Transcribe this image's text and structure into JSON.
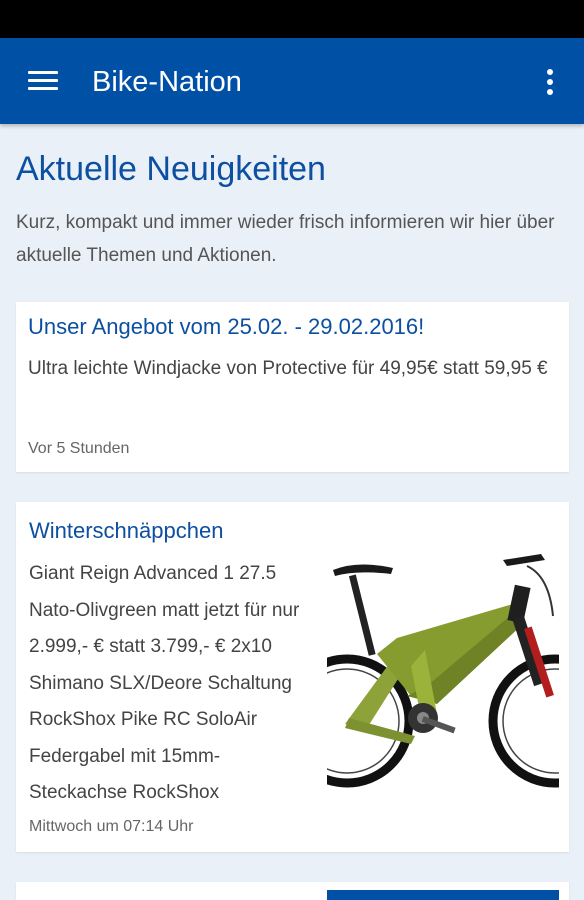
{
  "app": {
    "title": "Bike-Nation"
  },
  "header": {
    "menu_icon": "hamburger-menu-icon",
    "overflow_icon": "more-vertical-icon",
    "bar_color": "#0050a6"
  },
  "page": {
    "heading": "Aktuelle Neuigkeiten",
    "intro": "Kurz, kompakt und immer wieder frisch informieren wir hier über aktuelle Themen und Aktionen."
  },
  "news": [
    {
      "title": "Unser Angebot vom 25.02. - 29.02.2016!",
      "text": "Ultra leichte Windjacke von Protective für 49,95€ statt 59,95 €",
      "time": "Vor 5 Stunden"
    },
    {
      "title": "Winterschnäppchen",
      "text": "Giant Reign Advanced 1 27.5 Nato-Olivgreen matt jetzt für nur 2.999,- € statt 3.799,- € 2x10 Shimano SLX/Deore Schaltung RockShox Pike RC SoloAir Federgabel mit 15mm-Steckachse RockShox",
      "time": "Mittwoch um 07:14 Uhr",
      "image": "mountain-bike-photo"
    }
  ]
}
